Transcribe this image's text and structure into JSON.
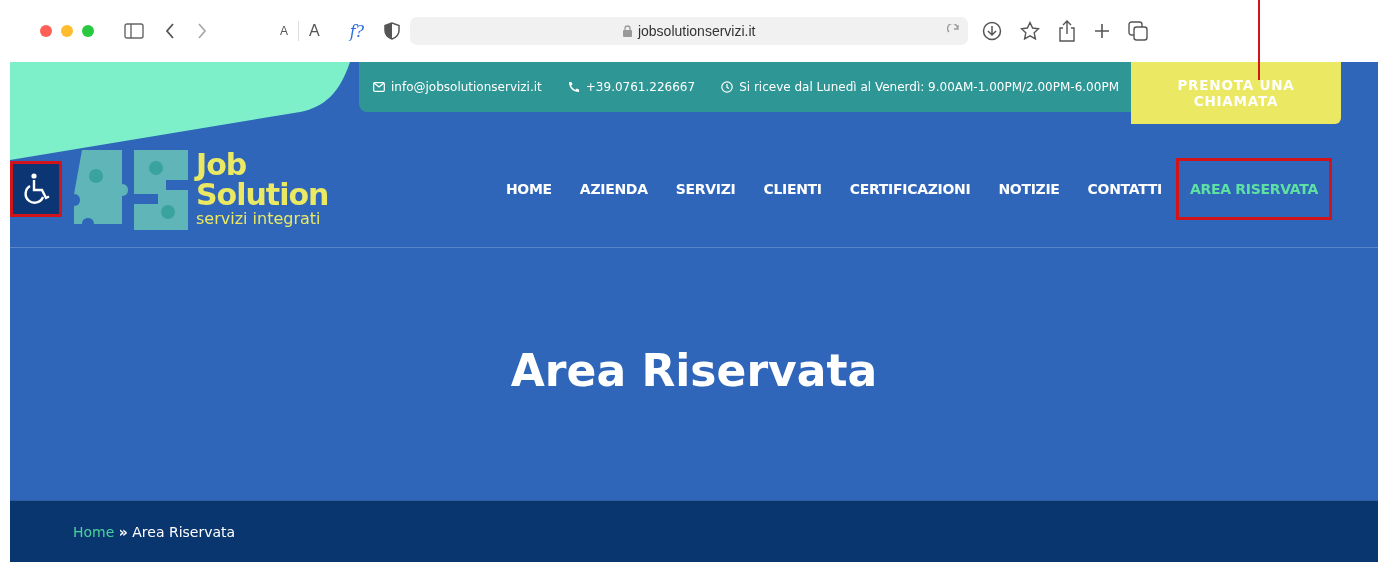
{
  "browser": {
    "text_size_buttons": [
      "A",
      "A"
    ],
    "extension_label": "f?",
    "url": "jobsolutionservizi.it"
  },
  "top_bar": {
    "email": "info@jobsolutionservizi.it",
    "phone": "+39.0761.226667",
    "hours": "Si riceve dal Lunedì al Venerdì: 9.00AM-1.00PM/2.00PM-6.00PM",
    "cta": "PRENOTA UNA CHIAMATA"
  },
  "accessibility_button": {
    "highlighted": true
  },
  "logo": {
    "line_1": "Job",
    "line_2": "Solution",
    "tagline": "servizi integrati"
  },
  "nav": [
    {
      "label": "HOME",
      "selected": false,
      "highlighted": false
    },
    {
      "label": "AZIENDA",
      "selected": false,
      "highlighted": false
    },
    {
      "label": "SERVIZI",
      "selected": false,
      "highlighted": false
    },
    {
      "label": "CLIENTI",
      "selected": false,
      "highlighted": false
    },
    {
      "label": "CERTIFICAZIONI",
      "selected": false,
      "highlighted": false
    },
    {
      "label": "NOTIZIE",
      "selected": false,
      "highlighted": false
    },
    {
      "label": "CONTATTI",
      "selected": false,
      "highlighted": false
    },
    {
      "label": "AREA RISERVATA",
      "selected": true,
      "highlighted": true
    }
  ],
  "hero": {
    "title": "Area Riservata"
  },
  "breadcrumb": {
    "home": "Home",
    "separator": "»",
    "current": "Area Riservata"
  }
}
